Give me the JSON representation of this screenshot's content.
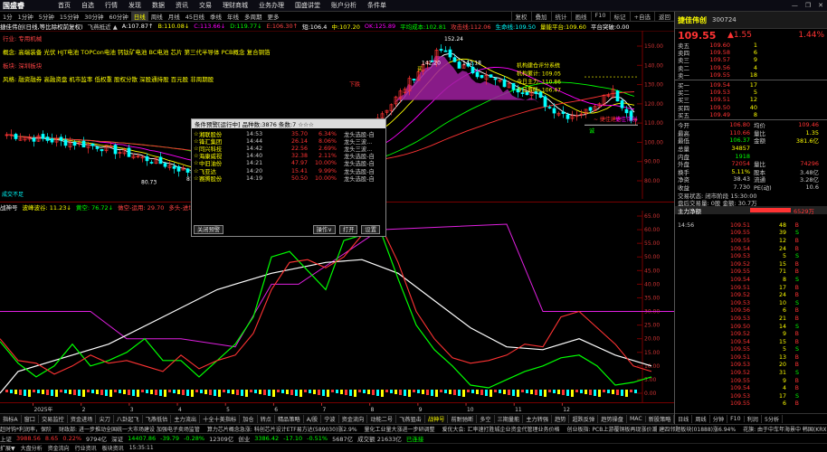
{
  "app": {
    "logo": "国盛睿",
    "menu": [
      "首页",
      "自选",
      "行情",
      "发现",
      "数据",
      "资讯",
      "交易",
      "理财商城",
      "业务办理",
      "国盛讲堂",
      "账户分析",
      "条件单"
    ],
    "win_buttons": [
      "—",
      "❐",
      "✕"
    ]
  },
  "period_bar": {
    "items": [
      "1分",
      "1分钟",
      "5分钟",
      "15分钟",
      "30分钟",
      "60分钟",
      "日线",
      "周线",
      "月线",
      "45日线",
      "季线",
      "年线",
      "多周期",
      "更多"
    ],
    "active_index": 6,
    "right_tools": [
      "复权",
      "叠加",
      "统计",
      "画线",
      "F10",
      "标记",
      "+自选",
      "返回"
    ]
  },
  "ma_bar": [
    {
      "text": "捷佳伟创(日线,等比除权前复权)",
      "color": "#ffffff"
    },
    {
      "text": "飞燕抵近 ▲",
      "color": "#cccccc"
    },
    {
      "text": "A:107.87↑",
      "color": "#ffffff"
    },
    {
      "text": "B:110.08↓",
      "color": "#ffff00"
    },
    {
      "text": "C:113.66↓",
      "color": "#ff00ff"
    },
    {
      "text": "D:119.77↓",
      "color": "#00ff00"
    },
    {
      "text": "E:106.30↑",
      "color": "#ff4444"
    },
    {
      "text": "短:106.4",
      "color": "#ffffff"
    },
    {
      "text": "中:107.20",
      "color": "#ffff00"
    },
    {
      "text": "OK:125.89",
      "color": "#ff00ff"
    },
    {
      "text": "平均成本:102.81",
      "color": "#00ff00"
    },
    {
      "text": "攻击线:112.06",
      "color": "#ff4444"
    },
    {
      "text": "生命线:109.50",
      "color": "#00ffff"
    },
    {
      "text": "量能平台:109.60",
      "color": "#ffff00"
    },
    {
      "text": "平台突破:0.00",
      "color": "#ffffff"
    }
  ],
  "concepts": [
    {
      "text": "行业: 专用机械",
      "color": "#ff4444"
    },
    {
      "text": "概念: 高端装备 光伏 HJT电池 TOPCon电池 钙钛矿电池 BC电池 芯片 第三代半导体 PCB概念 复合铜箔",
      "color": "#ffff00"
    },
    {
      "text": "板块: 深圳板块",
      "color": "#ff4444"
    },
    {
      "text": "风格: 融资融券 高融资盘 机市监率 低权重 股权分散 深股通持股 百元股 非周期股",
      "color": "#ffff00"
    }
  ],
  "chart_labels": {
    "high": "152.24",
    "mid_high": "142.20",
    "mid_high2": "142.18",
    "low1": "84.61",
    "low2": "80.73",
    "low3": "81.52",
    "stop_label": "下跌",
    "buy_label": "买",
    "stock_buy_label": "~ 捷佳建仓",
    "watch": [
      "机构建仓评分系统",
      "机构累计: 109.05",
      "今日主力: 110.86",
      "今日筹码: 106.47"
    ],
    "right_axis_label": "捷佳伟创",
    "yaxis": [
      "150.00",
      "140.00",
      "130.00",
      "120.00",
      "110.00",
      "100.00",
      "90.00",
      "80.00"
    ],
    "vol_label": "成交不足",
    "jkbox_label": "诚"
  },
  "indicator_bar": [
    {
      "text": "战神号",
      "color": "#ffffff"
    },
    {
      "text": "波峰波谷: 11.23↓",
      "color": "#ffff00"
    },
    {
      "text": "黄空: 76.72↓",
      "color": "#00ff00"
    },
    {
      "text": "做空-运用: 29.70",
      "color": "#ff4444"
    },
    {
      "text": "多头-进场: 0.00",
      "color": "#ff4444"
    },
    {
      "text": "叉头: --",
      "color": "#00ff00"
    }
  ],
  "sub_yaxis": [
    "65.00",
    "60.00",
    "55.00",
    "50.00",
    "45.00",
    "40.00",
    "35.00",
    "30.00",
    "25.00",
    "20.00",
    "15.00",
    "10.00",
    "5.00",
    "0.00"
  ],
  "xaxis_labels": [
    "2025年",
    "2",
    "3",
    "4",
    "5",
    "6",
    "7",
    "8",
    "9",
    "10",
    "11",
    "12"
  ],
  "tabs": [
    "指标A",
    "窗口",
    "交易监控",
    "资金进场",
    "尖刀",
    "八卦起飞",
    "飞燕低估",
    "主力流出",
    "十全十美指标",
    "加仓",
    "转点",
    "精品策略",
    "A/股",
    "宁波",
    "资金流向",
    "动能二号",
    "飞燕狙击",
    "战神号",
    "前耐驰断",
    "多空",
    "三期量能",
    "主力转强",
    "趋势",
    "超跌反弹",
    "趋势操盘",
    "MAC",
    "新股策略",
    "跌破分批",
    "大盘风险",
    "新疆擒龙"
  ],
  "active_tab_index": 17,
  "popup": {
    "title": "条件预警[运行中] 品种数:3876 条数:7 ☆☆☆",
    "rows": [
      {
        "name": "湘联股份",
        "time": "14:53",
        "price": "35.70",
        "pct": "6.34%",
        "signal": "龙头选股-自"
      },
      {
        "name": "锋汇集团",
        "time": "14:44",
        "price": "26.14",
        "pct": "8.06%",
        "signal": "龙头三波..."
      },
      {
        "name": "同兴科技",
        "time": "14:42",
        "price": "22.56",
        "pct": "2.69%",
        "signal": "龙头三波..."
      },
      {
        "name": "海康威视",
        "time": "14:40",
        "price": "32.38",
        "pct": "2.11%",
        "signal": "龙头选股-自"
      },
      {
        "name": "中旧油份",
        "time": "14:21",
        "price": "47.97",
        "pct": "10.00%",
        "signal": "龙头选股-自"
      },
      {
        "name": "飞亚达",
        "time": "14:20",
        "price": "15.41",
        "pct": "9.99%",
        "signal": "龙头选股-自"
      },
      {
        "name": "赛腾股份",
        "time": "14:19",
        "price": "50.50",
        "pct": "10.00%",
        "signal": "龙头选股-自"
      }
    ],
    "buttons": {
      "close": "关闭预警",
      "op": "操作∨",
      "open": "打开",
      "settings": "设置"
    }
  },
  "quote": {
    "name": "捷佳伟创",
    "code": "300724",
    "price": "109.55",
    "change": "▲1.55",
    "pct": "1.44%",
    "sells": [
      {
        "label": "卖五",
        "price": "109.60",
        "vol": "1"
      },
      {
        "label": "卖四",
        "price": "109.58",
        "vol": "6"
      },
      {
        "label": "卖三",
        "price": "109.57",
        "vol": "9"
      },
      {
        "label": "卖二",
        "price": "109.56",
        "vol": "4"
      },
      {
        "label": "卖一",
        "price": "109.55",
        "vol": "18"
      }
    ],
    "buys": [
      {
        "label": "买一",
        "price": "109.54",
        "vol": "17"
      },
      {
        "label": "买二",
        "price": "109.53",
        "vol": "5"
      },
      {
        "label": "买三",
        "price": "109.51",
        "vol": "12"
      },
      {
        "label": "买四",
        "price": "109.50",
        "vol": "40"
      },
      {
        "label": "买五",
        "price": "109.49",
        "vol": "8"
      }
    ],
    "stats": [
      {
        "l": "今开",
        "v": "106.80",
        "vc": "#f33",
        "l2": "均价",
        "v2": "109.46",
        "v2c": "#f33"
      },
      {
        "l": "最高",
        "v": "110.66",
        "vc": "#f33",
        "l2": "量比",
        "v2": "1.35",
        "v2c": "#ff0"
      },
      {
        "l": "最低",
        "v": "106.37",
        "vc": "#0f0",
        "l2": "金额",
        "v2": "381.6亿",
        "v2c": "#ff0"
      },
      {
        "l": "总量",
        "v": "34857",
        "vc": "#ff0",
        "l2": "",
        "v2": "",
        "v2c": "#ff0"
      },
      {
        "l": "内盘",
        "v": "1918",
        "vc": "#0f0",
        "l2": "",
        "v2": "",
        "v2c": "#ff0"
      },
      {
        "l": "外盘",
        "v": "72054",
        "vc": "#f33",
        "l2": "量比",
        "v2": "74296",
        "v2c": "#f33"
      },
      {
        "l": "换手",
        "v": "5.11%",
        "vc": "#ff0",
        "l2": "股本",
        "v2": "3.48亿",
        "v2c": "#ccc"
      },
      {
        "l": "净资",
        "v": "38.43",
        "vc": "#ccc",
        "l2": "流通",
        "v2": "3.28亿",
        "v2c": "#ccc"
      },
      {
        "l": "收益",
        "v": "7.730",
        "vc": "#ccc",
        "l2": "PE(动)",
        "v2": "10.6",
        "v2c": "#ccc"
      }
    ],
    "trade_status": "交易状态: 闭市阶段 15:30:00",
    "last_trade": "盘后交易量: 0股  金额: 30.7万",
    "net_flow_label": "主力净额",
    "net_flow": "6529万",
    "ticks": [
      {
        "t": "14:56",
        "p": "109.51",
        "v": "48",
        "f": "B"
      },
      {
        "t": "",
        "p": "109.55",
        "v": "39",
        "f": "S"
      },
      {
        "t": "",
        "p": "109.55",
        "v": "12",
        "f": "B"
      },
      {
        "t": "",
        "p": "109.54",
        "v": "24",
        "f": "B"
      },
      {
        "t": "",
        "p": "109.53",
        "v": "5",
        "f": "S"
      },
      {
        "t": "",
        "p": "109.52",
        "v": "15",
        "f": "B"
      },
      {
        "t": "",
        "p": "109.55",
        "v": "71",
        "f": "B"
      },
      {
        "t": "",
        "p": "109.54",
        "v": "8",
        "f": "S"
      },
      {
        "t": "",
        "p": "109.51",
        "v": "17",
        "f": "B"
      },
      {
        "t": "",
        "p": "109.52",
        "v": "24",
        "f": "B"
      },
      {
        "t": "",
        "p": "109.53",
        "v": "10",
        "f": "S"
      },
      {
        "t": "",
        "p": "109.56",
        "v": "6",
        "f": "B"
      },
      {
        "t": "",
        "p": "109.53",
        "v": "21",
        "f": "B"
      },
      {
        "t": "",
        "p": "109.50",
        "v": "14",
        "f": "S"
      },
      {
        "t": "",
        "p": "109.52",
        "v": "9",
        "f": "B"
      },
      {
        "t": "",
        "p": "109.54",
        "v": "15",
        "f": "B"
      },
      {
        "t": "",
        "p": "109.55",
        "v": "5",
        "f": "S"
      },
      {
        "t": "",
        "p": "109.51",
        "v": "13",
        "f": "B"
      },
      {
        "t": "",
        "p": "109.53",
        "v": "20",
        "f": "B"
      },
      {
        "t": "",
        "p": "109.52",
        "v": "31",
        "f": "S"
      },
      {
        "t": "",
        "p": "109.55",
        "v": "9",
        "f": "B"
      },
      {
        "t": "",
        "p": "109.54",
        "v": "4",
        "f": "B"
      },
      {
        "t": "",
        "p": "109.53",
        "v": "17",
        "f": "S"
      },
      {
        "t": "",
        "p": "109.55",
        "v": "6",
        "f": "B"
      }
    ],
    "rtabs": [
      "日线",
      "周线",
      "分钟",
      "F10",
      "利润",
      "5分析"
    ]
  },
  "news": [
    "赶时钩*利润率，保阶",
    "财政部: 进一步推动全国统一大市场建设 加强电子卖场监管",
    "算力芯片概念急涨: 科创芯片设计ETF易方达(589030)涨2.9%",
    "量化工业量大涨进一步研调整",
    "爱优大会: 汇率速打胜城企业资金代管理业务价格",
    "创业板指: PCB上游覆铜板再现涨价潮 建四邻题板块(01888)涨6.94%",
    "花旗: 由于中车年海景中  韩国(KRX)涨0.6%"
  ],
  "status": [
    {
      "text": "上证",
      "color": "#ccc"
    },
    {
      "text": "3988.56",
      "color": "#f33"
    },
    {
      "text": "8.65",
      "color": "#f33"
    },
    {
      "text": "0.22%",
      "color": "#f33"
    },
    {
      "text": "9794亿",
      "color": "#ccc"
    },
    {
      "text": "深证",
      "color": "#ccc"
    },
    {
      "text": "14407.86",
      "color": "#0f0"
    },
    {
      "text": "-39.79",
      "color": "#0f0"
    },
    {
      "text": "-0.28%",
      "color": "#0f0"
    },
    {
      "text": "12309亿",
      "color": "#ccc"
    },
    {
      "text": "创业",
      "color": "#ccc"
    },
    {
      "text": "3386.42",
      "color": "#0f0"
    },
    {
      "text": "-17.10",
      "color": "#0f0"
    },
    {
      "text": "-0.51%",
      "color": "#0f0"
    },
    {
      "text": "5687亿",
      "color": "#ccc"
    },
    {
      "text": "成交额 21633亿",
      "color": "#ccc"
    },
    {
      "text": "已连接",
      "color": "#0f0"
    }
  ],
  "bottomline": [
    "扩展▼",
    "大盘分析",
    "资金流向",
    "行业资讯",
    "板块资讯",
    "15:35:11"
  ]
}
